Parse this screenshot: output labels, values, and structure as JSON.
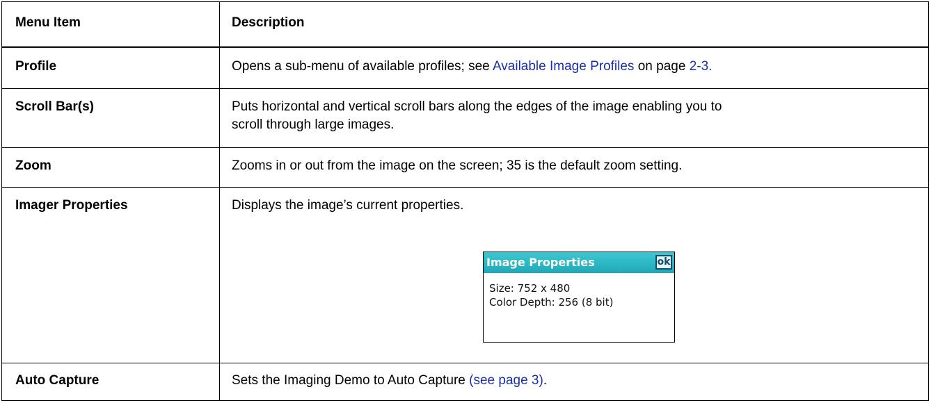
{
  "table": {
    "headers": {
      "menu_item": "Menu Item",
      "description": "Description"
    },
    "rows": [
      {
        "menu_item": "Profile",
        "description_text": "Opens a sub-menu of available profiles; see ",
        "link_text": "Available Image Profiles",
        "description_mid": " on page ",
        "page_link": "2-3.",
        "colors": {
          "link": "#1a2faa"
        }
      },
      {
        "menu_item": "Scroll Bar(s)",
        "description_line1": "Puts horizontal and vertical scroll bars along the edges of the image enabling you to",
        "description_line2": "scroll through large images."
      },
      {
        "menu_item": "Zoom",
        "description": "Zooms in or out from the image on the screen; 35 is the default zoom setting."
      },
      {
        "menu_item": "Imager Properties",
        "description": "Displays the image’s current properties.",
        "dialog": {
          "title": "Image Properties",
          "ok_label": "ok",
          "size_line": "Size: 752 x 480",
          "depth_line": "Color Depth: 256 (8 bit)",
          "colors": {
            "title_bar": "#2bb8c4",
            "title_text": "#ffffff"
          }
        }
      },
      {
        "menu_item": "Auto Capture",
        "description_text": "Sets the Imaging Demo to Auto Capture ",
        "link_text": "(see page 3)",
        "description_end": "."
      }
    ]
  }
}
